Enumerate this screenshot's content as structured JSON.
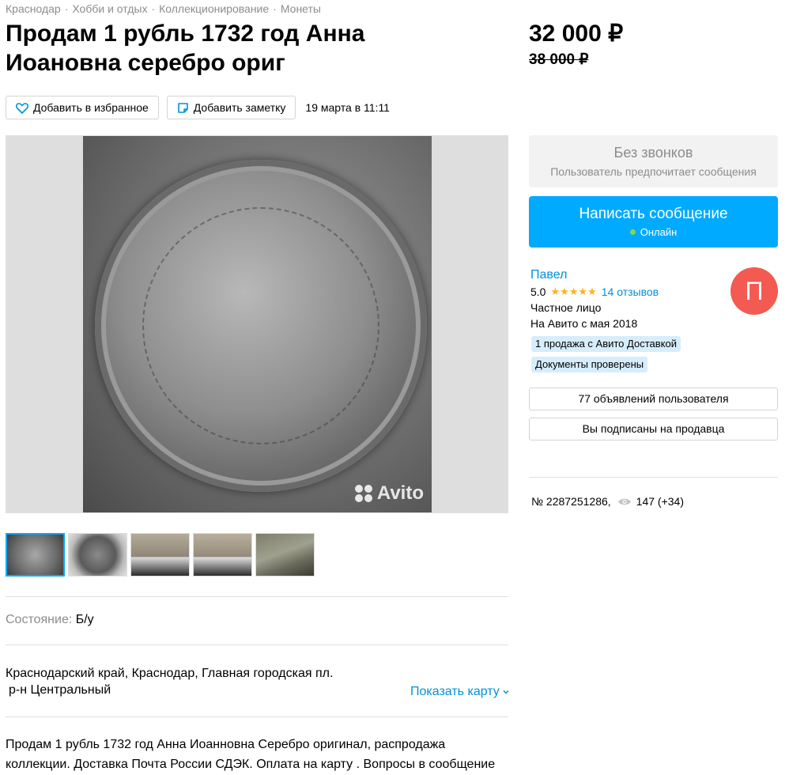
{
  "breadcrumbs": [
    "Краснодар",
    "Хобби и отдых",
    "Коллекционирование",
    "Монеты"
  ],
  "breadcrumb_separator": "·",
  "title": "Продам 1 рубль 1732 год Анна Иоановна серебро ориг",
  "price": "32 000 ₽",
  "old_price": "38 000 ₽",
  "actions": {
    "favorite_label": "Добавить в избранное",
    "note_label": "Добавить заметку",
    "date": "19 марта в 11:11"
  },
  "gallery": {
    "watermark": "Avito",
    "thumbnail_count": 5,
    "active_thumbnail": 1
  },
  "condition": {
    "label": "Состояние:",
    "value": "Б/у"
  },
  "location": {
    "address": "Краснодарский край, Краснодар, Главная городская пл.",
    "district": "р-н Центральный",
    "show_map_label": "Показать карту"
  },
  "description": "Продам 1 рубль 1732 год Анна Иоанновна Серебро оригинал, распродажа коллекции. Доставка Почта России СДЭК. Оплата на карту . Вопросы в сообщение",
  "contact": {
    "no_calls_title": "Без звонков",
    "no_calls_subtitle": "Пользователь предпочитает сообщения",
    "write_message_label": "Написать сообщение",
    "online_label": "Онлайн"
  },
  "seller": {
    "name": "Павел",
    "rating": "5.0",
    "stars": "★★★★★",
    "reviews": "14 отзывов",
    "type": "Частное лицо",
    "since": "На Авито с мая 2018",
    "badges": [
      "1 продажа с Авито Доставкой",
      "Документы проверены"
    ],
    "avatar_letter": "П",
    "avatar_color": "#f25a52",
    "ads_button": "77 объявлений пользователя",
    "subscribed_button": "Вы подписаны на продавца"
  },
  "ad": {
    "number": "№ 2287251286,",
    "views": "147 (+34)"
  },
  "colors": {
    "accent": "#00aaff",
    "link": "#0091d9",
    "online": "#8bd64b",
    "star": "#ffb021",
    "badge_bg": "#d6edfb"
  }
}
